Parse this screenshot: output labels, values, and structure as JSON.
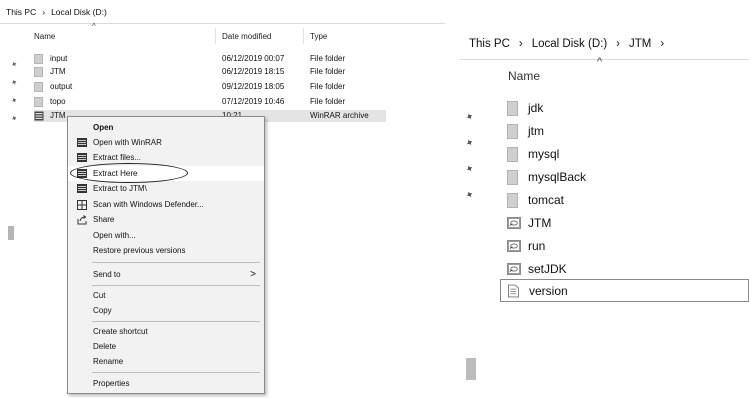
{
  "left_pane": {
    "breadcrumb": [
      "This PC",
      "Local Disk (D:)"
    ],
    "separator": "›",
    "columns": {
      "name": "Name",
      "date": "Date modified",
      "type": "Type"
    },
    "files": [
      {
        "name": "input",
        "date": "06/12/2019 00:07",
        "type": "File folder"
      },
      {
        "name": "JTM",
        "date": "06/12/2019 18:15",
        "type": "File folder"
      },
      {
        "name": "output",
        "date": "09/12/2019 18:05",
        "type": "File folder"
      },
      {
        "name": "topo",
        "date": "07/12/2019 10:46",
        "type": "File folder"
      },
      {
        "name": "JTM",
        "date": "10:21",
        "type": "WinRAR archive"
      }
    ],
    "context_menu": {
      "open": "Open",
      "open_with_winrar": "Open with WinRAR",
      "extract_files": "Extract files...",
      "extract_here": "Extract Here",
      "extract_to": "Extract to JTM\\",
      "scan_defender": "Scan with Windows Defender...",
      "share": "Share",
      "open_with": "Open with...",
      "restore": "Restore previous versions",
      "send_to": "Send to",
      "send_to_arrow": ">",
      "cut": "Cut",
      "copy": "Copy",
      "create_shortcut": "Create shortcut",
      "delete": "Delete",
      "rename": "Rename",
      "properties": "Properties"
    }
  },
  "right_pane": {
    "breadcrumb": [
      "This PC",
      "Local Disk (D:)",
      "JTM"
    ],
    "separator": "›",
    "name_header": "Name",
    "items": [
      {
        "name": "jdk",
        "kind": "folder"
      },
      {
        "name": "jtm",
        "kind": "folder"
      },
      {
        "name": "mysql",
        "kind": "folder"
      },
      {
        "name": "mysqlBack",
        "kind": "folder"
      },
      {
        "name": "tomcat",
        "kind": "folder"
      },
      {
        "name": "JTM",
        "kind": "shortcut"
      },
      {
        "name": "run",
        "kind": "shortcut"
      },
      {
        "name": "setJDK",
        "kind": "shortcut"
      },
      {
        "name": "version",
        "kind": "text"
      }
    ]
  },
  "icons": {
    "pin": "pin-icon",
    "sort": "sort-up-icon",
    "winrar": "winrar-icon",
    "shield": "shield-icon",
    "share": "share-icon"
  },
  "colors": {
    "selection": "#e4e4e4",
    "menu_bg": "#f2f2f2",
    "menu_hover": "#ffffff"
  }
}
